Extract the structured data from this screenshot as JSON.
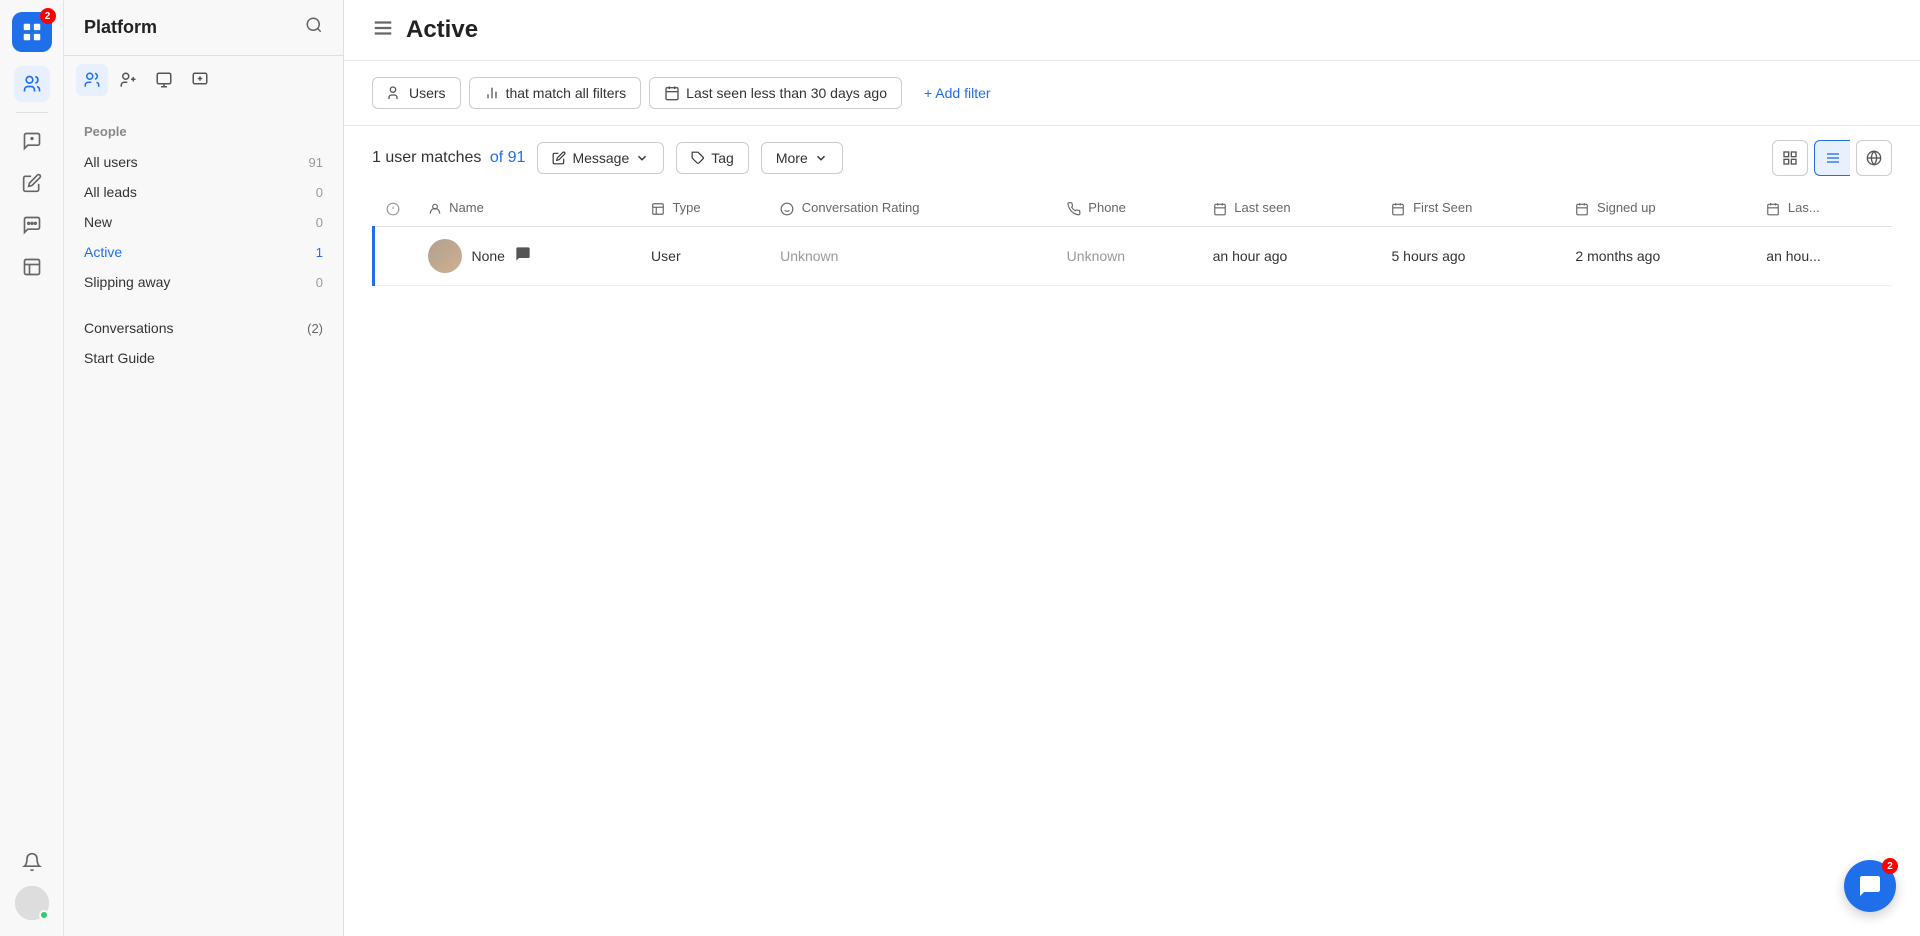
{
  "app": {
    "logo_badge": "2",
    "title": "Platform"
  },
  "sidebar": {
    "title": "Platform",
    "search_icon": "search",
    "people_label": "People",
    "nav_items": [
      {
        "id": "all-users",
        "label": "All users",
        "count": "91",
        "active": false
      },
      {
        "id": "all-leads",
        "label": "All leads",
        "count": "0",
        "active": false
      },
      {
        "id": "new",
        "label": "New",
        "count": "0",
        "active": false
      },
      {
        "id": "active",
        "label": "Active",
        "count": "1",
        "active": true
      },
      {
        "id": "slipping-away",
        "label": "Slipping away",
        "count": "0",
        "active": false
      }
    ],
    "conversations_label": "Conversations",
    "conversations_count": "(2)",
    "start_guide_label": "Start Guide"
  },
  "topbar": {
    "page_title": "Active"
  },
  "filters": {
    "users_label": "Users",
    "match_label": "that match all filters",
    "last_seen_label": "Last seen less than 30 days ago",
    "add_filter_label": "+ Add filter"
  },
  "toolbar": {
    "match_text": "1 user matches",
    "of_text": "of 91",
    "message_label": "Message",
    "tag_label": "Tag",
    "more_label": "More"
  },
  "table": {
    "columns": [
      {
        "id": "name",
        "label": "Name",
        "icon": "user"
      },
      {
        "id": "type",
        "label": "Type",
        "icon": "type"
      },
      {
        "id": "conversation_rating",
        "label": "Conversation Rating",
        "icon": "smile"
      },
      {
        "id": "phone",
        "label": "Phone",
        "icon": "phone"
      },
      {
        "id": "last_seen",
        "label": "Last seen",
        "icon": "calendar"
      },
      {
        "id": "first_seen",
        "label": "First Seen",
        "icon": "calendar"
      },
      {
        "id": "signed_up",
        "label": "Signed up",
        "icon": "calendar"
      },
      {
        "id": "last_active",
        "label": "Las...",
        "icon": "calendar"
      }
    ],
    "rows": [
      {
        "name": "None",
        "has_chat": true,
        "type": "User",
        "conversation_rating": "Unknown",
        "phone": "Unknown",
        "last_seen": "an hour ago",
        "first_seen": "5 hours ago",
        "signed_up": "2 months ago",
        "last_active": "an hou..."
      }
    ]
  },
  "chat_widget": {
    "badge": "2"
  }
}
